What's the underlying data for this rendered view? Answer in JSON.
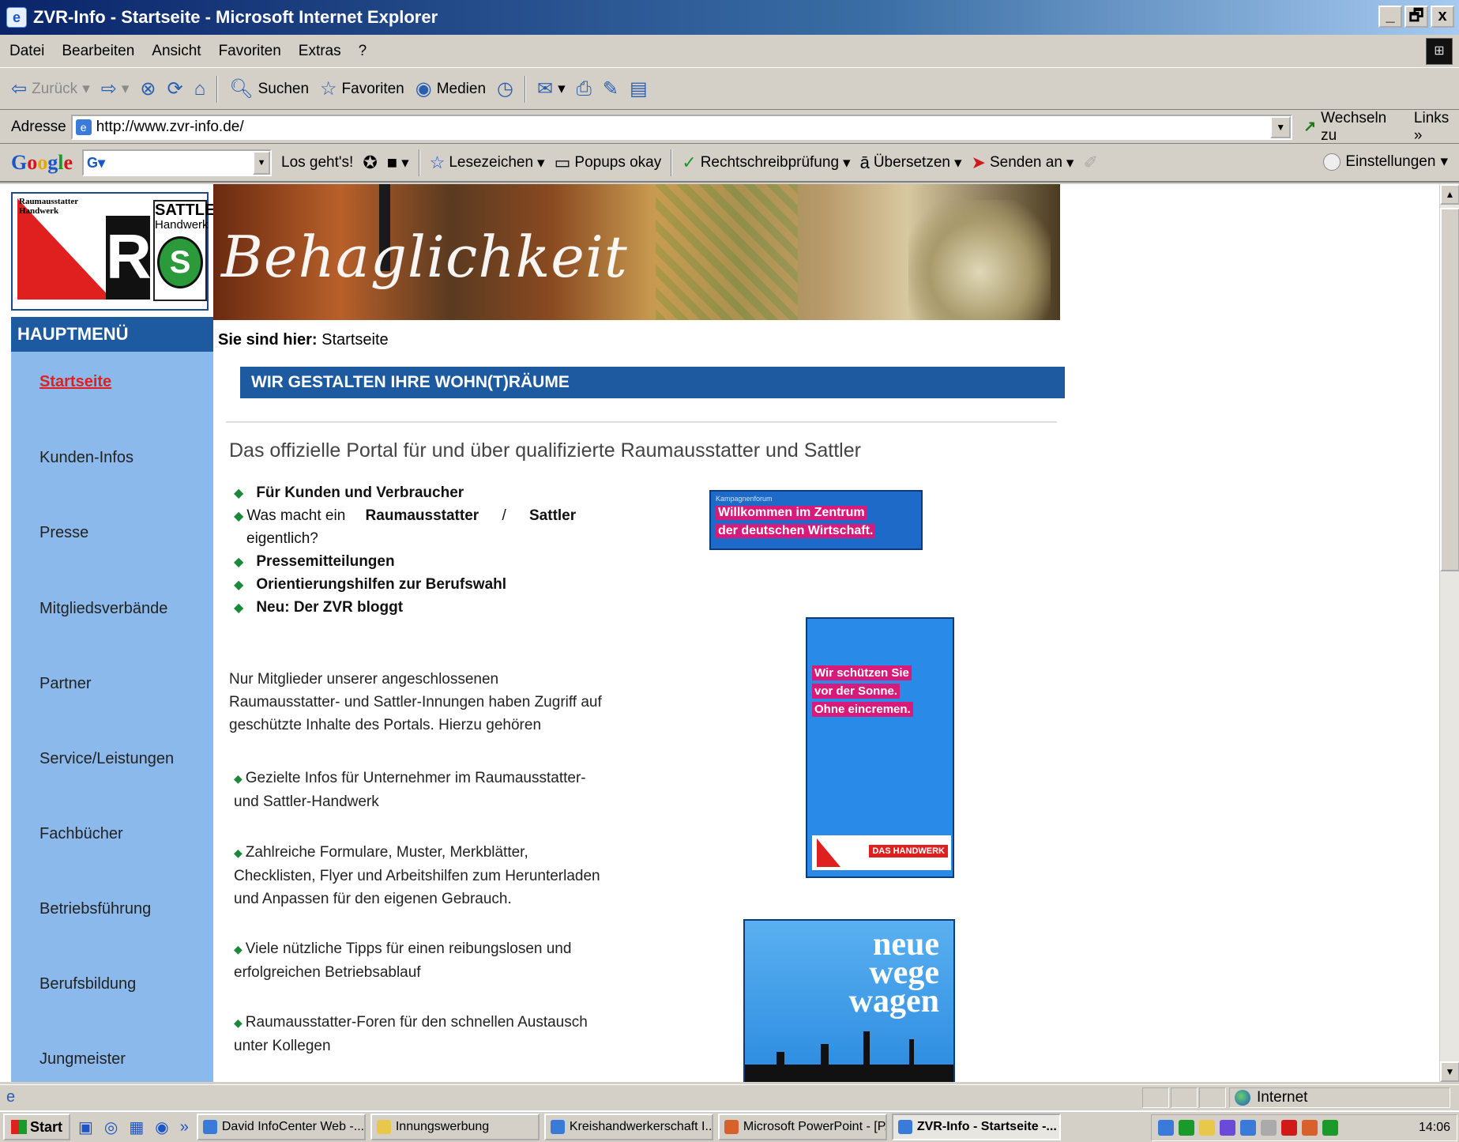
{
  "window": {
    "title": "ZVR-Info - Startseite - Microsoft Internet Explorer",
    "buttons": [
      "_",
      "🗗",
      "x"
    ]
  },
  "menu": [
    "Datei",
    "Bearbeiten",
    "Ansicht",
    "Favoriten",
    "Extras",
    "?"
  ],
  "toolbar": {
    "back": "Zurück",
    "search": "Suchen",
    "favorites": "Favoriten",
    "media": "Medien"
  },
  "address": {
    "label": "Adresse",
    "url": "http://www.zvr-info.de/",
    "go": "Wechseln zu",
    "links": "Links »"
  },
  "google": {
    "logo": [
      "G",
      "o",
      "o",
      "g",
      "l",
      "e"
    ],
    "box": "G",
    "search_btn": "Los geht's!",
    "bookmarks": "Lesezeichen",
    "popups": "Popups okay",
    "spellcheck": "Rechtschreibprüfung",
    "translate": "Übersetzen",
    "send": "Senden an",
    "settings": "Einstellungen"
  },
  "logo": {
    "left_text_1": "Raumausstatter",
    "left_text_2": "Handwerk",
    "r_letter": "R",
    "sattler_1": "SATTLER",
    "sattler_2": "Handwerk",
    "s_letter": "S"
  },
  "banner": {
    "script": "Behaglichkeit"
  },
  "nav": {
    "header": "HAUPTMENÜ",
    "items": [
      "Startseite",
      "Kunden-Infos",
      "Presse",
      "Mitgliedsverbände",
      "Partner",
      "Service/Leistungen",
      "Fachbücher",
      "Betriebsführung",
      "Berufsbildung",
      "Jungmeister"
    ],
    "active": "Startseite"
  },
  "breadcrumb": {
    "label": "Sie sind hier:",
    "current": "Startseite"
  },
  "content": {
    "band_title": "WIR GESTALTEN IHRE WOHN(T)RÄUME",
    "heading": "Das offizielle Portal für und über qualifizierte Raumausstatter und Sattler",
    "links": {
      "kunden": "Für Kunden und Verbraucher",
      "was_macht_prefix": "Was macht ein",
      "raumausstatter": "Raumausstatter",
      "slash": "/",
      "sattler": "Sattler",
      "eigentlich": "eigentlich?",
      "presse": "Pressemitteilungen",
      "orientierung": "Orientierungshilfen zur Berufswahl",
      "blog": "Neu: Der ZVR bloggt"
    },
    "members_para": "Nur Mitglieder unserer angeschlossenen Raumausstatter- und Sattler-Innungen haben Zugriff auf geschützte Inhalte des Portals. Hierzu gehören",
    "member_items": [
      "Gezielte Infos für Unternehmer im Raumausstatter- und Sattler-Handwerk",
      "Zahlreiche Formulare, Muster, Merkblätter, Checklisten, Flyer und Arbeitshilfen zum Herunterladen und Anpassen für den eigenen Gebrauch.",
      "Viele nützliche Tipps für einen reibungslosen und erfolgreichen Betriebsablauf",
      "Raumausstatter-Foren für den schnellen Austausch unter Kollegen"
    ]
  },
  "ads": {
    "ad1_small": "Kampagnenforum",
    "ad1_line1": "Willkommen im Zentrum",
    "ad1_line2": "der deutschen Wirtschaft.",
    "ad2_line1": "Wir schützen Sie",
    "ad2_line2": "vor der Sonne.",
    "ad2_line3": "Ohne eincremen.",
    "ad2_brand": "DAS HANDWERK",
    "ad3_line1": "neue",
    "ad3_line2": "wege",
    "ad3_line3": "wagen"
  },
  "status": {
    "zone": "Internet"
  },
  "taskbar": {
    "start": "Start",
    "tasks": [
      "David InfoCenter Web -...",
      "Innungswerbung",
      "Kreishandwerkerschaft I...",
      "Microsoft PowerPoint - [P...",
      "ZVR-Info - Startseite -..."
    ],
    "clock": "14:06"
  },
  "colors": {
    "nav_bg": "#8cb9ec",
    "nav_header": "#1e5aa0",
    "active_link": "#e0201f",
    "band": "#1e5aa0"
  }
}
